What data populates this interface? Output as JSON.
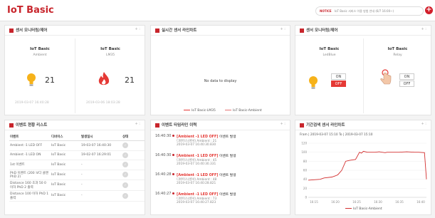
{
  "app": {
    "title": "IoT Basic",
    "add_label": "+"
  },
  "notice": {
    "tag": "NOTICE",
    "text": "IoT Basic 서비스 이용 방법 안내 (6/7 16:00~)"
  },
  "panels": {
    "sensor_monitor": {
      "title": "센서 모니터링/제어",
      "controls": "+ :",
      "devices": [
        {
          "name": "IoT Basic",
          "sub": "Ambient",
          "icon": "lightbulb-icon",
          "value": "21",
          "time": "2019-03-07 16:40:28"
        },
        {
          "name": "IoT Basic",
          "sub": "LM35",
          "icon": "flame-icon",
          "value": "21",
          "time": "2019-03-06 18:03:28"
        }
      ]
    },
    "realtime_chart": {
      "title": "실시간 센서 라인차트",
      "controls": "+ :",
      "no_data": "No data to display",
      "legend": [
        {
          "label": "IoT Basic-LM35",
          "color": "#e53935"
        },
        {
          "label": "IoT Basic-Ambient",
          "color": "#e57373"
        }
      ]
    },
    "control": {
      "title": "센서 모니터링/제어",
      "controls": "+ :",
      "devices": [
        {
          "name": "IoT Basic",
          "sub": "LedBlue",
          "icon": "lightbulb-icon",
          "on_label": "ON",
          "off_label": "OFF",
          "active": "OFF"
        },
        {
          "name": "IoT Basic",
          "sub": "Relay",
          "icon": "hand-touch-icon",
          "on_label": "ON",
          "off_label": "OFF",
          "active": "NONE"
        }
      ]
    },
    "event_list": {
      "title": "이벤트 현황 리스트",
      "controls": "+ :",
      "columns": [
        "이벤트",
        "디바이스",
        "발생일시",
        "상태"
      ],
      "rows": [
        [
          "Ambient -1 LED OFF",
          "IoT Basic",
          "19-03-07 16:40:30",
          ""
        ],
        [
          "Ambient -1 LED ON",
          "IoT Basic",
          "19-02-07 16:29:01",
          ""
        ],
        [
          "1st 이벤트",
          "IoT Basic",
          "-",
          ""
        ],
        [
          "PhD 이벤트 (200 보다 클땐 PhD 2)",
          "IoT Basic",
          "-",
          ""
        ],
        [
          "Distance 160 초과 50 0 이하 PhD 2 출력",
          "IoT Basic",
          "-",
          ""
        ],
        [
          "Distance 100 이하 PhD 1 출력",
          "IoT Basic",
          "-",
          ""
        ]
      ],
      "status_icon": "check-circle-icon"
    },
    "timeline": {
      "title": "이벤트 타임라인 이력",
      "controls": "+ :",
      "items": [
        {
          "time": "16:40:30",
          "event": "[Ambient -1 LED OFF]",
          "suffix": " 이벤트 발생",
          "detail": "디바이스(센서) Ambient : 21",
          "stamp": "2019-03-07 16:40:30.830"
        },
        {
          "time": "16:40:30",
          "event": "[Ambient -1 LED OFF]",
          "suffix": " 이벤트 발생",
          "detail": "디바이스(센서) Ambient : 45",
          "stamp": "2019-03-07 16:40:30.331"
        },
        {
          "time": "16:40:28",
          "event": "[Ambient -1 LED OFF]",
          "suffix": " 이벤트 발생",
          "detail": "디바이스(센서) Ambient : 48",
          "stamp": "2019-03-07 16:40:28.821"
        },
        {
          "time": "16:40:27",
          "event": "[Ambient -1 LED OFF]",
          "suffix": " 이벤트 발생",
          "detail": "디바이스(센서) Ambient : 73",
          "stamp": "2019-03-07 16:40:27.823"
        }
      ]
    },
    "period_chart": {
      "title": "기간검색 센서 라인차트",
      "controls": "+ :",
      "period": "Fram | 2019-03-07 15:10  To | 2019-03-07 15:10"
    }
  },
  "chart_data": {
    "type": "line",
    "title": "",
    "xlabel": "",
    "ylabel": "",
    "x_ticks": [
      "16:15",
      "16:20",
      "16:25",
      "16:30",
      "16:35",
      "16:40"
    ],
    "y_ticks": [
      "0",
      "20",
      "40",
      "60",
      "80",
      "100",
      "120"
    ],
    "ylim": [
      0,
      120
    ],
    "xlim": [
      12.0,
      42.0
    ],
    "x_unit_note_minutes_past_16": true,
    "series": [
      {
        "name": "IoT Basic-Ambient",
        "color": "#d32f2f",
        "x": [
          12.0,
          15.0,
          16.0,
          18.0,
          19.0,
          19.5,
          20.5,
          21.5,
          22.5,
          24.0,
          25.0,
          25.5,
          26.0,
          27.0,
          29.0,
          30.0,
          31.5,
          32.0,
          33.0,
          35.0,
          37.0,
          39.0,
          40.0,
          41.5,
          42.0
        ],
        "y": [
          38,
          40,
          43,
          45,
          48,
          50,
          60,
          80,
          82,
          84,
          100,
          98,
          102,
          100,
          100,
          101,
          99,
          100,
          100,
          100,
          101,
          100,
          100,
          99,
          40
        ]
      }
    ]
  }
}
